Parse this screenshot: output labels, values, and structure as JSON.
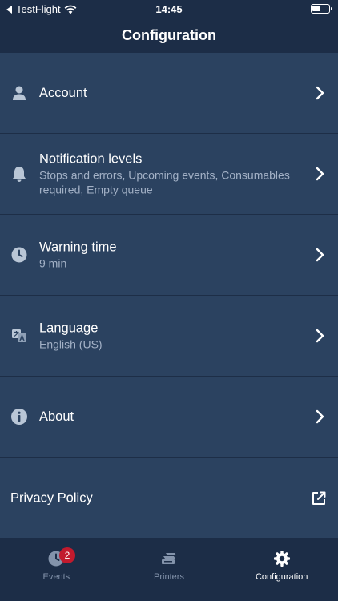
{
  "status_bar": {
    "back_app": "TestFlight",
    "time": "14:45"
  },
  "nav": {
    "title": "Configuration"
  },
  "rows": [
    {
      "label": "Account",
      "sub": "",
      "icon": "person-icon"
    },
    {
      "label": "Notification levels",
      "sub": "Stops and errors, Upcoming events, Consumables required, Empty queue",
      "icon": "bell-icon"
    },
    {
      "label": "Warning time",
      "sub": "9 min",
      "icon": "clock-icon"
    },
    {
      "label": "Language",
      "sub": "English (US)",
      "icon": "translate-icon"
    },
    {
      "label": "About",
      "sub": "",
      "icon": "info-icon"
    }
  ],
  "privacy": {
    "label": "Privacy Policy",
    "icon": "external-link-icon"
  },
  "tabs": [
    {
      "label": "Events",
      "badge": "2",
      "icon": "events-icon"
    },
    {
      "label": "Printers",
      "icon": "printers-icon"
    },
    {
      "label": "Configuration",
      "icon": "gear-icon"
    }
  ],
  "colors": {
    "nav": "#1c2d47",
    "row": "#2b4260",
    "badge": "#c21a2d",
    "muted": "#a3b1c6"
  }
}
